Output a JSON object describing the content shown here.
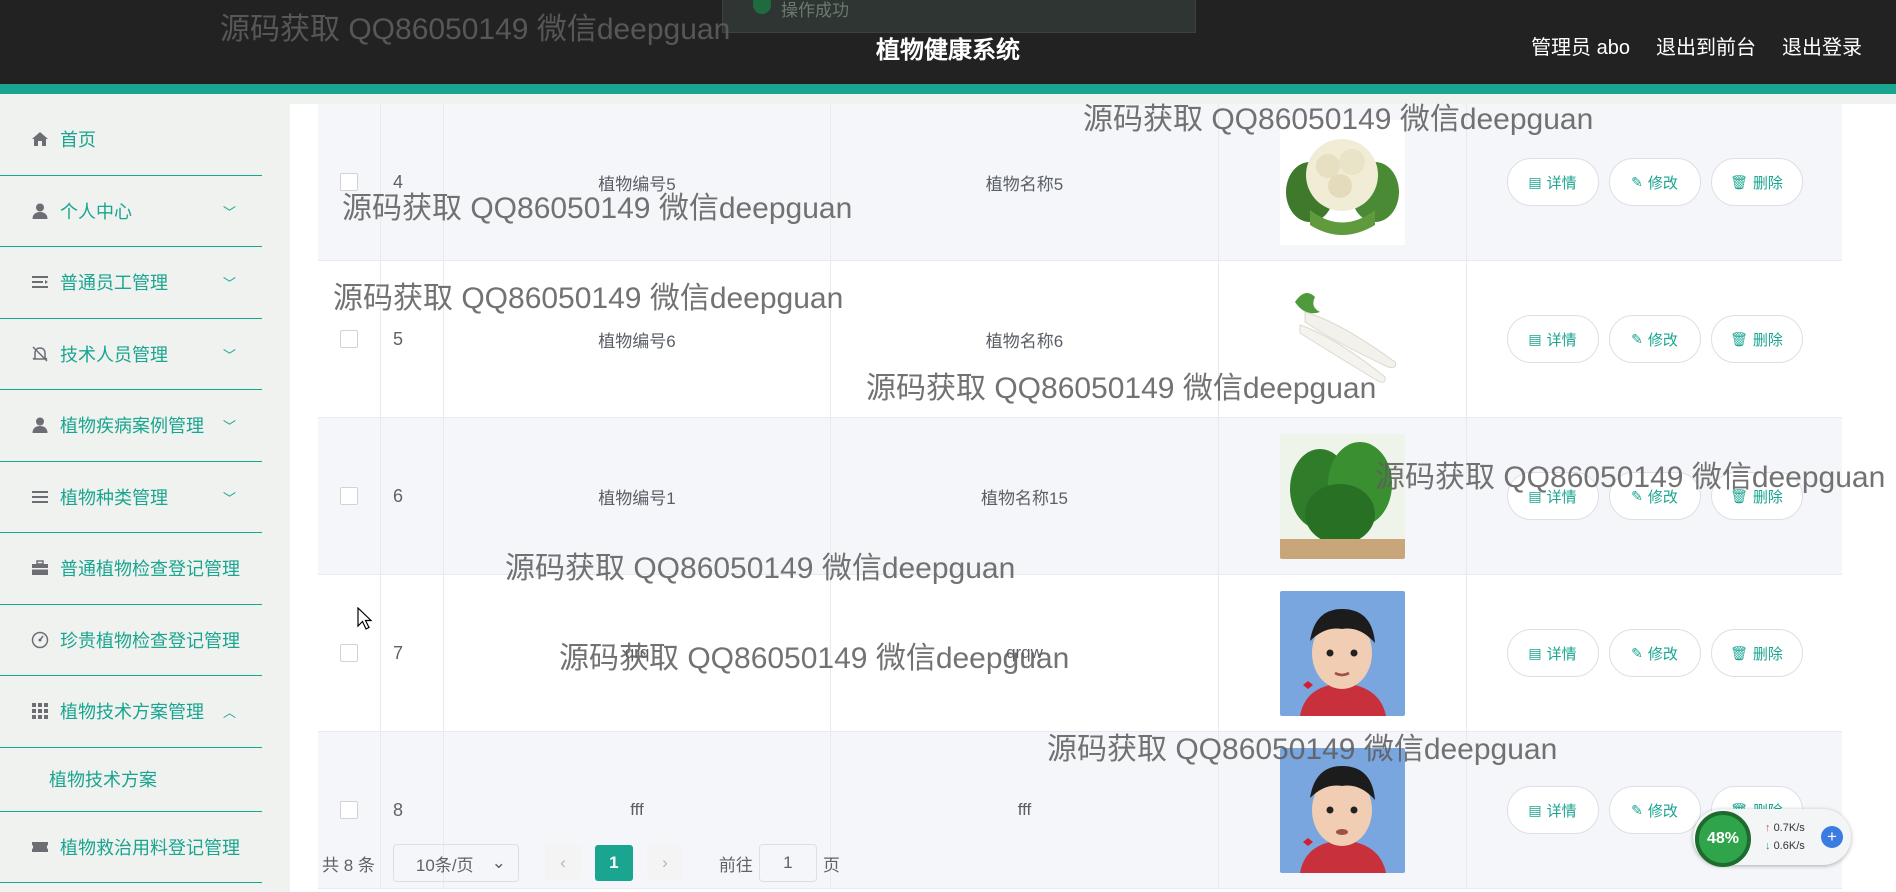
{
  "header": {
    "toast": "操作成功",
    "title": "植物健康系统",
    "nav": [
      "管理员 abo",
      "退出到前台",
      "退出登录"
    ]
  },
  "sidebar": {
    "items": [
      {
        "label": "首页",
        "icon": "home-icon",
        "chevron": ""
      },
      {
        "label": "个人中心",
        "icon": "user-icon",
        "chevron": "﹀"
      },
      {
        "label": "普通员工管理",
        "icon": "list-icon",
        "chevron": "﹀"
      },
      {
        "label": "技术人员管理",
        "icon": "bell-off-icon",
        "chevron": "﹀"
      },
      {
        "label": "植物疾病案例管理",
        "icon": "user-icon",
        "chevron": "﹀"
      },
      {
        "label": "植物种类管理",
        "icon": "menu-icon",
        "chevron": "﹀"
      },
      {
        "label": "普通植物检查登记管理",
        "icon": "briefcase-icon",
        "chevron": ""
      },
      {
        "label": "珍贵植物检查登记管理",
        "icon": "gauge-icon",
        "chevron": ""
      },
      {
        "label": "植物技术方案管理",
        "icon": "grid-icon",
        "chevron": "︿"
      },
      {
        "label": "植物救治用料登记管理",
        "icon": "ticket-icon",
        "chevron": ""
      }
    ],
    "submenu_label": "植物技术方案"
  },
  "table": {
    "actions": {
      "detail": "详情",
      "edit": "修改",
      "delete": "删除"
    },
    "rows": [
      {
        "index": "4",
        "code": "植物编号5",
        "name": "植物名称5",
        "image": "cauliflower"
      },
      {
        "index": "5",
        "code": "植物编号6",
        "name": "植物名称6",
        "image": "radish"
      },
      {
        "index": "6",
        "code": "植物编号1",
        "name": "植物名称15",
        "image": "greens"
      },
      {
        "index": "7",
        "code": "qrq",
        "name": "qrqw",
        "image": "person-photo"
      },
      {
        "index": "8",
        "code": "fff",
        "name": "fff",
        "image": "person-photo"
      }
    ]
  },
  "pagination": {
    "total": "共 8 条",
    "page_size": "10条/页",
    "current_page": "1",
    "goto_label": "前往",
    "goto_value": "1",
    "page_suffix": "页"
  },
  "watermark": "源码获取 QQ86050149 微信deepguan",
  "speed_widget": {
    "percent": "48%",
    "up": "0.7K/s",
    "down": "0.6K/s"
  },
  "colors": {
    "accent": "#19a58f",
    "topbar": "#222222"
  }
}
